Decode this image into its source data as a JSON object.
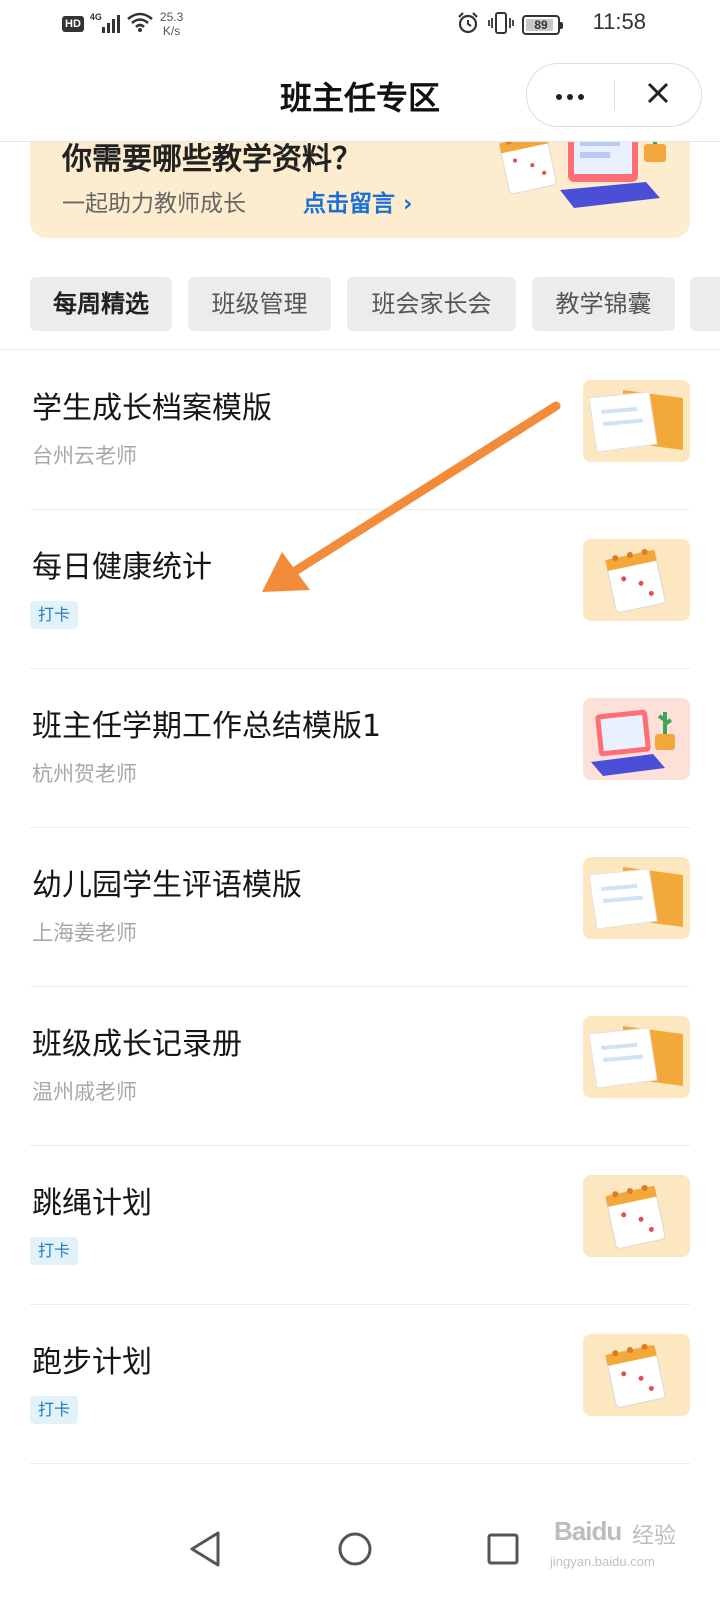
{
  "status_bar": {
    "hd_label": "HD",
    "network_type": "4G",
    "net_speed_value": "25.3",
    "net_speed_unit": "K/s",
    "battery_level": 89,
    "battery_text": "89",
    "time": "11:58",
    "icons": [
      "signal-icon",
      "wifi-icon",
      "alarm-icon",
      "vibrate-icon",
      "battery-icon"
    ]
  },
  "nav": {
    "title": "班主任专区",
    "more_icon": "more-dots-icon",
    "close_icon": "close-icon"
  },
  "banner": {
    "title": "你需要哪些教学资料？",
    "subtitle": "一起助力教师成长",
    "link_label": "点击留言",
    "link_chevron": "›",
    "accent_color": "#1b6fd8",
    "background_color": "#fdeccd"
  },
  "tabs": [
    {
      "label": "每周精选",
      "active": true
    },
    {
      "label": "班级管理",
      "active": false
    },
    {
      "label": "班会家长会",
      "active": false
    },
    {
      "label": "教学锦囊",
      "active": false
    }
  ],
  "list": [
    {
      "title": "学生成长档案模版",
      "author": "台州云老师",
      "tag": "",
      "thumb": "document-thumb"
    },
    {
      "title": "每日健康统计",
      "author": "",
      "tag": "打卡",
      "thumb": "calendar-thumb"
    },
    {
      "title": "班主任学期工作总结模版1",
      "author": "杭州贺老师",
      "tag": "",
      "thumb": "laptop-thumb"
    },
    {
      "title": "幼儿园学生评语模版",
      "author": "上海姜老师",
      "tag": "",
      "thumb": "document-thumb"
    },
    {
      "title": "班级成长记录册",
      "author": "温州戚老师",
      "tag": "",
      "thumb": "document-thumb"
    },
    {
      "title": "跳绳计划",
      "author": "",
      "tag": "打卡",
      "thumb": "calendar-thumb"
    },
    {
      "title": "跑步计划",
      "author": "",
      "tag": "打卡",
      "thumb": "calendar-thumb"
    }
  ],
  "annotation": {
    "type": "arrow",
    "color": "#f28c3a"
  },
  "system_nav": {
    "icons": [
      "back-icon",
      "home-icon",
      "recents-icon"
    ]
  },
  "watermark": {
    "logo": "Baidu",
    "text": "经验",
    "url": "jingyan.baidu.com"
  }
}
